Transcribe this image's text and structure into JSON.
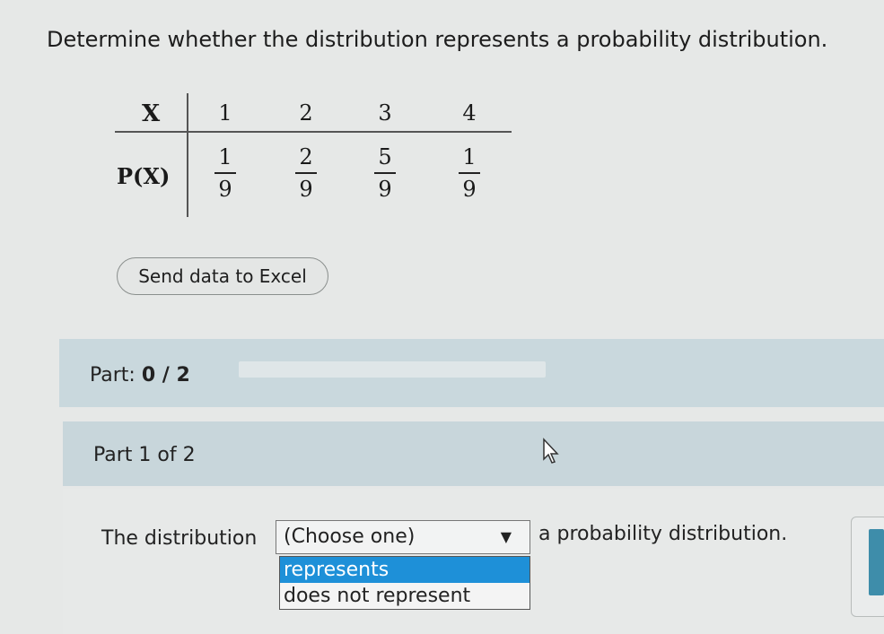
{
  "question": "Determine whether the distribution represents a probability distribution.",
  "table": {
    "x_header": "X",
    "p_header": "P(X)",
    "x_values": [
      "1",
      "2",
      "3",
      "4"
    ],
    "probabilities": [
      {
        "num": "1",
        "den": "9"
      },
      {
        "num": "2",
        "den": "9"
      },
      {
        "num": "5",
        "den": "9"
      },
      {
        "num": "1",
        "den": "9"
      }
    ]
  },
  "excel_button": "Send data to Excel",
  "part": {
    "label": "Part:",
    "progress_text": "0 / 2",
    "progress_fraction": 0
  },
  "part1": {
    "label": "Part 1 of 2",
    "sentence_before": "The distribution",
    "sentence_after": "a probability distribution.",
    "select_value": "(Choose one)",
    "options": [
      "represents",
      "does not represent"
    ],
    "highlighted_option": "represents"
  },
  "colors": {
    "highlight": "#1e90d8",
    "part_bar": "#c9d8dd",
    "accent": "#3e8daa"
  }
}
